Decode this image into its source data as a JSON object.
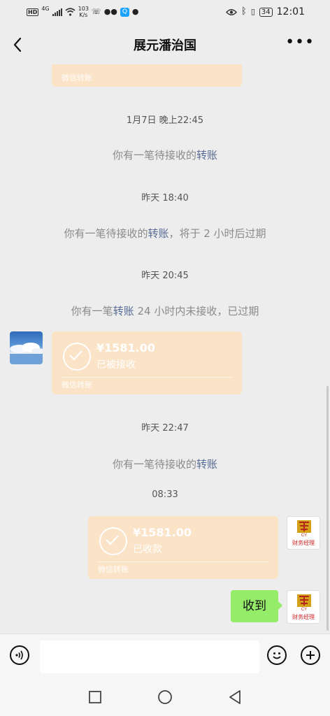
{
  "status_bar": {
    "hd": "HD",
    "network": "4G",
    "speed_value": "103",
    "speed_unit": "K/s",
    "battery": "34",
    "time": "12:01",
    "icons": [
      "hd-icon",
      "signal-icon",
      "wifi-icon",
      "missed-call-icon",
      "wechat-icon",
      "qq-icon",
      "message-icon",
      "eye-icon",
      "bluetooth-icon",
      "vibrate-icon",
      "battery-icon"
    ]
  },
  "header": {
    "title": "展元潘治国",
    "back_icon": "chevron-left-icon",
    "more_icon": "more-icon"
  },
  "messages": {
    "top_card_footer": "微信转账",
    "ts1": "1月7日 晚上22:45",
    "sys1": {
      "pre": "你有一笔待接收的",
      "link": "转账",
      "post": ""
    },
    "ts2": "昨天 18:40",
    "sys2": {
      "pre": "你有一笔待接收的",
      "link": "转账",
      "post": "，将于 2 小时后过期"
    },
    "ts3": "昨天 20:45",
    "sys3": {
      "pre": "你有一笔",
      "link": "转账",
      "post": " 24 小时内未接收，已过期"
    },
    "card1": {
      "amount": "¥1581.00",
      "status": "已被接收",
      "footer": "微信转账"
    },
    "ts4": "昨天 22:47",
    "sys4": {
      "pre": "你有一笔待接收的",
      "link": "转账",
      "post": ""
    },
    "ts5": "08:33",
    "card2": {
      "amount": "¥1581.00",
      "status": "已收款",
      "footer": "微信转账"
    },
    "reply": "收到",
    "avatar_caption": "财务经理",
    "avatar_letters": "CY"
  },
  "colors": {
    "background": "#ededed",
    "transfer_card": "#fbe3c7",
    "link": "#576b95",
    "my_bubble": "#95ec69"
  },
  "input_bar": {
    "voice_icon": "voice-icon",
    "emoji_icon": "emoji-icon",
    "add_icon": "plus-circle-icon",
    "value": ""
  },
  "nav_bar": {
    "icons": [
      "square-icon",
      "circle-icon",
      "triangle-back-icon"
    ]
  }
}
